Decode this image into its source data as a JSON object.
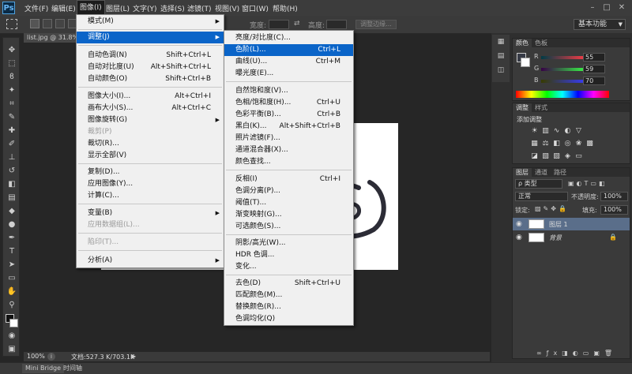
{
  "menubar": {
    "logo": "Ps",
    "items": [
      "文件(F)",
      "编辑(E)",
      "图像(I)",
      "图层(L)",
      "文字(Y)",
      "选择(S)",
      "滤镜(T)",
      "视图(V)",
      "窗口(W)",
      "帮助(H)"
    ],
    "window_buttons": [
      "–",
      "□",
      "✕"
    ]
  },
  "options_bar": {
    "width_label": "宽度:",
    "height_label": "高度:",
    "refine_edge_label": "调整边缘...",
    "workspace": "基本功能"
  },
  "document": {
    "tab_title": "list.jpg @ 31.8% (图"
  },
  "image_menu": {
    "items": [
      {
        "label": "模式(M)",
        "shortcut": "",
        "submenu": true
      },
      {
        "label": "调整(J)",
        "shortcut": "",
        "submenu": true,
        "highlight": true
      },
      {
        "label": "自动色调(N)",
        "shortcut": "Shift+Ctrl+L"
      },
      {
        "label": "自动对比度(U)",
        "shortcut": "Alt+Shift+Ctrl+L"
      },
      {
        "label": "自动颜色(O)",
        "shortcut": "Shift+Ctrl+B"
      },
      {
        "label": "图像大小(I)...",
        "shortcut": "Alt+Ctrl+I"
      },
      {
        "label": "画布大小(S)...",
        "shortcut": "Alt+Ctrl+C"
      },
      {
        "label": "图像旋转(G)",
        "shortcut": "",
        "submenu": true
      },
      {
        "label": "裁剪(P)",
        "shortcut": "",
        "disabled": true
      },
      {
        "label": "裁切(R)...",
        "shortcut": ""
      },
      {
        "label": "显示全部(V)",
        "shortcut": ""
      },
      {
        "label": "复制(D)...",
        "shortcut": ""
      },
      {
        "label": "应用图像(Y)...",
        "shortcut": ""
      },
      {
        "label": "计算(C)...",
        "shortcut": ""
      },
      {
        "label": "变量(B)",
        "shortcut": "",
        "submenu": true
      },
      {
        "label": "应用数据组(L)...",
        "shortcut": "",
        "disabled": true
      },
      {
        "label": "陷印(T)...",
        "shortcut": "",
        "disabled": true
      },
      {
        "label": "分析(A)",
        "shortcut": "",
        "submenu": true
      }
    ]
  },
  "adjust_menu": {
    "items": [
      {
        "label": "亮度/对比度(C)...",
        "shortcut": ""
      },
      {
        "label": "色阶(L)...",
        "shortcut": "Ctrl+L",
        "highlight": true
      },
      {
        "label": "曲线(U)...",
        "shortcut": "Ctrl+M"
      },
      {
        "label": "曝光度(E)...",
        "shortcut": ""
      },
      {
        "label": "自然饱和度(V)...",
        "shortcut": ""
      },
      {
        "label": "色相/饱和度(H)...",
        "shortcut": "Ctrl+U"
      },
      {
        "label": "色彩平衡(B)...",
        "shortcut": "Ctrl+B"
      },
      {
        "label": "黑白(K)...",
        "shortcut": "Alt+Shift+Ctrl+B"
      },
      {
        "label": "照片滤镜(F)...",
        "shortcut": ""
      },
      {
        "label": "通道混合器(X)...",
        "shortcut": ""
      },
      {
        "label": "颜色查找...",
        "shortcut": ""
      },
      {
        "label": "反相(I)",
        "shortcut": "Ctrl+I"
      },
      {
        "label": "色调分离(P)...",
        "shortcut": ""
      },
      {
        "label": "阈值(T)...",
        "shortcut": ""
      },
      {
        "label": "渐变映射(G)...",
        "shortcut": ""
      },
      {
        "label": "可选颜色(S)...",
        "shortcut": ""
      },
      {
        "label": "阴影/高光(W)...",
        "shortcut": ""
      },
      {
        "label": "HDR 色调...",
        "shortcut": ""
      },
      {
        "label": "变化...",
        "shortcut": ""
      },
      {
        "label": "去色(D)",
        "shortcut": "Shift+Ctrl+U"
      },
      {
        "label": "匹配颜色(M)...",
        "shortcut": ""
      },
      {
        "label": "替换颜色(R)...",
        "shortcut": ""
      },
      {
        "label": "色调均化(Q)",
        "shortcut": ""
      }
    ]
  },
  "color_panel": {
    "tabs": [
      "颜色",
      "色板"
    ],
    "r_label": "R",
    "r_value": "55",
    "g_label": "G",
    "g_value": "59",
    "b_label": "B",
    "b_value": "70"
  },
  "adjustments_panel": {
    "tabs": [
      "调整",
      "样式"
    ],
    "title": "添加调整"
  },
  "layers_panel": {
    "tabs": [
      "图层",
      "通道",
      "路径"
    ],
    "filter": "ρ 类型",
    "blend_mode": "正常",
    "opacity_label": "不透明度:",
    "opacity_value": "100%",
    "lock_label": "锁定:",
    "fill_label": "填充:",
    "fill_value": "100%",
    "layers": [
      {
        "name": "图层 1"
      },
      {
        "name": "背景"
      }
    ]
  },
  "status_bar": {
    "zoom": "100%",
    "doc_info": "文档:527.3 K/703.1K"
  },
  "bottom_bar": {
    "tabs": [
      "Mini Bridge",
      "时间轴"
    ]
  }
}
